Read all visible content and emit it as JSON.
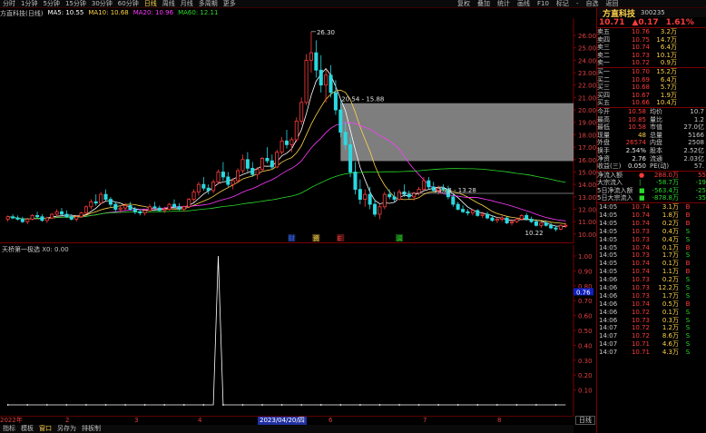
{
  "periods": [
    "分时",
    "1分钟",
    "5分钟",
    "15分钟",
    "30分钟",
    "60分钟",
    "日线",
    "周线",
    "月线",
    "多周期",
    "更多"
  ],
  "active_period": "日线",
  "right_tools": [
    "复权",
    "叠加",
    "统计",
    "画线",
    "F10",
    "标记",
    "-",
    "自选",
    "返回"
  ],
  "ma_legend": {
    "title": "方直科技(日线)",
    "ma5": "MA5: 10.55",
    "ma10": "MA10: 10.68",
    "ma20": "MA20: 10.96",
    "ma60": "MA60: 12.11",
    "colors": {
      "ma5": "#ffffff",
      "ma10": "#ffd24a",
      "ma20": "#ff3bff",
      "ma60": "#2bd92b"
    }
  },
  "price_axis": [
    "26.00",
    "25.00",
    "24.00",
    "23.00",
    "22.00",
    "21.00",
    "20.00",
    "19.00",
    "18.00",
    "17.00",
    "16.00",
    "15.00",
    "14.00",
    "13.00",
    "12.00",
    "11.00",
    "10.00"
  ],
  "annotations": {
    "high": "26.30",
    "range_box": "20.54 - 15.88",
    "line_label": "13.28 - 13.28",
    "low": "10.22"
  },
  "markers": [
    "财",
    "资",
    "E",
    "调"
  ],
  "sub_legend": "天桥第一极选 X0: 0.00",
  "sub_axis": [
    "1.00",
    "0.90",
    "0.80",
    "0.70",
    "0.60",
    "0.50",
    "0.40",
    "0.30",
    "0.20",
    "0.10"
  ],
  "sub_cursor": "0.76",
  "dates": [
    "2022年",
    "2",
    "3",
    "4",
    "2023/04/20/四",
    "6",
    "7",
    "8"
  ],
  "bottom_tabs": [
    "指标",
    "模板",
    "窗口",
    "另存为",
    "排板制"
  ],
  "active_bottom_tab": "窗口",
  "period_ctrl": "日线",
  "stock": {
    "name": "方直科技",
    "code": "300235",
    "price": "10.71",
    "change": "▲0.17",
    "pct": "1.61%"
  },
  "asks": [
    {
      "label": "卖五",
      "price": "10.76",
      "vol": "3.2万",
      "chg": ""
    },
    {
      "label": "卖四",
      "price": "10.75",
      "vol": "14.7万",
      "chg": ""
    },
    {
      "label": "卖三",
      "price": "10.74",
      "vol": "6.4万",
      "chg": ""
    },
    {
      "label": "卖二",
      "price": "10.73",
      "vol": "10.1万",
      "chg": ""
    },
    {
      "label": "卖一",
      "price": "10.72",
      "vol": "0.9万",
      "chg": ""
    }
  ],
  "bids": [
    {
      "label": "买一",
      "price": "10.70",
      "vol": "15.2万",
      "chg": ""
    },
    {
      "label": "买二",
      "price": "10.69",
      "vol": "6.4万",
      "chg": ""
    },
    {
      "label": "买三",
      "price": "10.68",
      "vol": "5.7万",
      "chg": ""
    },
    {
      "label": "买四",
      "price": "10.67",
      "vol": "1.9万",
      "chg": ""
    },
    {
      "label": "买五",
      "price": "10.66",
      "vol": "10.4万",
      "chg": ""
    }
  ],
  "stats": [
    {
      "l1": "今开",
      "v1": "10.58",
      "c1": "red",
      "l2": "均价",
      "v2": "10.7"
    },
    {
      "l1": "最高",
      "v1": "10.85",
      "c1": "red",
      "l2": "量比",
      "v2": "1.2"
    },
    {
      "l1": "最低",
      "v1": "10.58",
      "c1": "red",
      "l2": "市值",
      "v2": "27.0亿"
    },
    {
      "l1": "现量",
      "v1": "48",
      "c1": "yel",
      "l2": "总量",
      "v2": "5166"
    },
    {
      "l1": "外盘",
      "v1": "26574",
      "c1": "red",
      "l2": "内盘",
      "v2": "2508"
    },
    {
      "l1": "换手",
      "v1": "2.54%",
      "c1": "white",
      "l2": "股本",
      "v2": "2.52亿"
    },
    {
      "l1": "净资",
      "v1": "2.76",
      "c1": "white",
      "l2": "流通",
      "v2": "2.03亿"
    },
    {
      "l1": "收益(三)",
      "v1": "0.050",
      "c1": "white",
      "l2": "PE(动)",
      "v2": "57."
    }
  ],
  "flows": [
    {
      "label": "净流入额",
      "dot": "●",
      "v": "288.0万",
      "vc": "red",
      "v2": "55"
    },
    {
      "label": "大宗流入",
      "dot": "|",
      "v": "-58.7万",
      "vc": "green",
      "v2": "-19"
    },
    {
      "label": "5日净流入额",
      "dot": "■",
      "v": "-563.4万",
      "vc": "green",
      "v2": "-25"
    },
    {
      "label": "5日大宗流入",
      "dot": "■",
      "v": "-878.8万",
      "vc": "green",
      "v2": "-35"
    }
  ],
  "ticks": [
    {
      "t": "14:05",
      "p": "10.74",
      "v": "3.1万",
      "s": "B"
    },
    {
      "t": "14:05",
      "p": "10.74",
      "v": "1.8万",
      "s": "B"
    },
    {
      "t": "14:05",
      "p": "10.74",
      "v": "0.2万",
      "s": "B"
    },
    {
      "t": "14:05",
      "p": "10.73",
      "v": "0.4万",
      "s": "S"
    },
    {
      "t": "14:05",
      "p": "10.73",
      "v": "0.4万",
      "s": "S"
    },
    {
      "t": "14:05",
      "p": "10.74",
      "v": "0.1万",
      "s": "B"
    },
    {
      "t": "14:05",
      "p": "10.73",
      "v": "1.7万",
      "s": "S"
    },
    {
      "t": "14:05",
      "p": "10.74",
      "v": "0.1万",
      "s": "B"
    },
    {
      "t": "14:05",
      "p": "10.74",
      "v": "1.1万",
      "s": "B"
    },
    {
      "t": "14:06",
      "p": "10.73",
      "v": "0.2万",
      "s": "S"
    },
    {
      "t": "14:06",
      "p": "10.73",
      "v": "12.2万",
      "s": "S"
    },
    {
      "t": "14:06",
      "p": "10.73",
      "v": "1.7万",
      "s": "S"
    },
    {
      "t": "14:06",
      "p": "10.74",
      "v": "0.5万",
      "s": "B"
    },
    {
      "t": "14:06",
      "p": "10.72",
      "v": "0.1万",
      "s": "S"
    },
    {
      "t": "14:06",
      "p": "10.73",
      "v": "0.3万",
      "s": "S"
    },
    {
      "t": "14:07",
      "p": "10.72",
      "v": "1.2万",
      "s": "S"
    },
    {
      "t": "14:07",
      "p": "10.72",
      "v": "8.6万",
      "s": "S"
    },
    {
      "t": "14:07",
      "p": "10.71",
      "v": "4.6万",
      "s": "S"
    },
    {
      "t": "14:07",
      "p": "10.71",
      "v": "4.3万",
      "s": "S"
    }
  ],
  "colors": {
    "up": "#ff3b3b",
    "down": "#2bd9e0",
    "accent": "#ffd24a",
    "grid": "#7a0000"
  },
  "candles": [
    [
      11.2,
      11.5,
      11.0,
      11.4
    ],
    [
      11.4,
      11.6,
      11.2,
      11.3
    ],
    [
      11.3,
      11.5,
      11.1,
      11.2
    ],
    [
      11.2,
      11.4,
      10.9,
      11.0
    ],
    [
      11.0,
      11.3,
      10.8,
      11.2
    ],
    [
      11.2,
      11.6,
      11.1,
      11.5
    ],
    [
      11.5,
      11.8,
      11.3,
      11.4
    ],
    [
      11.4,
      11.6,
      11.0,
      11.1
    ],
    [
      11.1,
      11.4,
      10.9,
      11.3
    ],
    [
      11.3,
      11.7,
      11.2,
      11.6
    ],
    [
      11.6,
      12.0,
      11.4,
      11.8
    ],
    [
      11.8,
      12.1,
      11.5,
      11.6
    ],
    [
      11.6,
      11.9,
      11.3,
      11.4
    ],
    [
      11.4,
      11.6,
      11.1,
      11.2
    ],
    [
      11.2,
      11.5,
      11.0,
      11.4
    ],
    [
      11.4,
      11.8,
      11.3,
      11.7
    ],
    [
      11.7,
      12.3,
      11.6,
      12.2
    ],
    [
      12.2,
      12.8,
      12.0,
      12.6
    ],
    [
      12.6,
      13.2,
      12.3,
      12.5
    ],
    [
      12.5,
      13.4,
      12.4,
      13.2
    ],
    [
      13.2,
      13.6,
      12.7,
      12.8
    ],
    [
      12.8,
      13.0,
      12.2,
      12.4
    ],
    [
      12.4,
      12.6,
      11.8,
      12.0
    ],
    [
      12.0,
      12.3,
      11.7,
      12.1
    ],
    [
      12.1,
      12.5,
      11.9,
      12.3
    ],
    [
      12.3,
      12.6,
      11.9,
      12.0
    ],
    [
      12.0,
      12.2,
      11.6,
      11.8
    ],
    [
      11.8,
      12.0,
      11.5,
      11.7
    ],
    [
      11.7,
      12.0,
      11.5,
      11.9
    ],
    [
      11.9,
      12.4,
      11.8,
      12.2
    ],
    [
      12.2,
      12.6,
      12.0,
      12.1
    ],
    [
      12.1,
      12.3,
      11.8,
      11.9
    ],
    [
      11.9,
      12.2,
      11.7,
      12.0
    ],
    [
      12.0,
      12.5,
      11.9,
      12.4
    ],
    [
      12.4,
      12.8,
      12.1,
      12.2
    ],
    [
      12.2,
      12.5,
      11.9,
      12.0
    ],
    [
      12.0,
      12.3,
      11.8,
      12.2
    ],
    [
      12.2,
      12.9,
      12.1,
      12.8
    ],
    [
      12.8,
      13.6,
      12.6,
      13.4
    ],
    [
      13.4,
      14.2,
      13.1,
      14.0
    ],
    [
      14.0,
      14.6,
      13.5,
      13.7
    ],
    [
      13.7,
      14.0,
      13.2,
      13.5
    ],
    [
      13.5,
      14.4,
      13.3,
      14.2
    ],
    [
      14.2,
      15.2,
      14.0,
      15.0
    ],
    [
      15.0,
      15.8,
      14.3,
      14.6
    ],
    [
      14.6,
      15.0,
      13.8,
      14.0
    ],
    [
      14.0,
      14.5,
      13.6,
      14.3
    ],
    [
      14.3,
      15.3,
      14.1,
      15.1
    ],
    [
      15.1,
      16.4,
      14.9,
      16.0
    ],
    [
      16.0,
      16.6,
      15.0,
      15.3
    ],
    [
      15.3,
      15.8,
      14.6,
      14.8
    ],
    [
      14.8,
      15.4,
      14.4,
      15.2
    ],
    [
      15.2,
      16.2,
      15.0,
      16.1
    ],
    [
      16.1,
      17.0,
      15.7,
      15.9
    ],
    [
      15.9,
      16.4,
      15.2,
      15.4
    ],
    [
      15.4,
      16.8,
      15.3,
      16.6
    ],
    [
      16.6,
      17.8,
      16.4,
      17.5
    ],
    [
      17.5,
      18.4,
      16.9,
      17.2
    ],
    [
      17.2,
      17.8,
      16.6,
      17.6
    ],
    [
      17.6,
      19.4,
      17.4,
      19.1
    ],
    [
      19.1,
      21.0,
      18.8,
      20.6
    ],
    [
      20.6,
      24.5,
      20.4,
      24.0
    ],
    [
      24.0,
      26.3,
      23.0,
      24.6
    ],
    [
      24.6,
      25.6,
      22.6,
      23.2
    ],
    [
      23.2,
      24.4,
      21.4,
      22.0
    ],
    [
      22.0,
      23.2,
      20.6,
      22.8
    ],
    [
      22.8,
      23.6,
      21.0,
      21.4
    ],
    [
      21.4,
      22.4,
      19.6,
      20.0
    ],
    [
      20.0,
      20.8,
      17.8,
      18.2
    ],
    [
      18.2,
      19.0,
      16.8,
      17.2
    ],
    [
      17.2,
      17.8,
      14.6,
      15.0
    ],
    [
      15.0,
      15.8,
      13.2,
      13.6
    ],
    [
      13.6,
      14.4,
      12.4,
      12.8
    ],
    [
      12.8,
      13.6,
      12.2,
      13.2
    ],
    [
      13.2,
      13.8,
      12.0,
      12.4
    ],
    [
      12.4,
      12.8,
      11.4,
      11.6
    ],
    [
      11.6,
      12.4,
      11.2,
      12.2
    ],
    [
      12.2,
      13.4,
      12.0,
      13.2
    ],
    [
      13.2,
      13.6,
      12.8,
      13.0
    ],
    [
      13.0,
      13.4,
      12.6,
      12.8
    ],
    [
      12.8,
      13.6,
      12.7,
      13.4
    ],
    [
      13.4,
      14.0,
      13.0,
      13.2
    ],
    [
      13.2,
      13.5,
      12.8,
      13.0
    ],
    [
      13.0,
      13.4,
      12.7,
      13.3
    ],
    [
      13.3,
      13.8,
      13.1,
      13.6
    ],
    [
      13.6,
      14.6,
      13.5,
      14.3
    ],
    [
      14.3,
      14.6,
      13.6,
      13.8
    ],
    [
      13.8,
      14.2,
      13.4,
      13.5
    ],
    [
      13.5,
      13.9,
      13.2,
      13.7
    ],
    [
      13.7,
      14.0,
      13.4,
      13.6
    ],
    [
      13.6,
      13.9,
      12.8,
      13.0
    ],
    [
      13.0,
      13.2,
      12.2,
      12.4
    ],
    [
      12.4,
      12.6,
      11.9,
      12.0
    ],
    [
      12.0,
      12.3,
      11.7,
      11.8
    ],
    [
      11.8,
      12.0,
      11.5,
      11.7
    ],
    [
      11.7,
      12.0,
      11.5,
      11.9
    ],
    [
      11.9,
      12.0,
      11.4,
      11.5
    ],
    [
      11.5,
      11.8,
      11.3,
      11.6
    ],
    [
      11.6,
      11.8,
      11.2,
      11.3
    ],
    [
      11.3,
      11.5,
      11.0,
      11.1
    ],
    [
      11.1,
      11.4,
      10.9,
      11.2
    ],
    [
      11.2,
      11.5,
      11.0,
      11.3
    ],
    [
      11.3,
      11.4,
      10.8,
      10.9
    ],
    [
      10.9,
      11.2,
      10.7,
      11.0
    ],
    [
      11.0,
      11.3,
      10.9,
      11.2
    ],
    [
      11.2,
      11.6,
      11.1,
      11.5
    ],
    [
      11.5,
      11.7,
      11.1,
      11.2
    ],
    [
      11.2,
      11.4,
      10.9,
      11.0
    ],
    [
      11.0,
      11.2,
      10.6,
      10.7
    ],
    [
      10.7,
      11.0,
      10.5,
      10.9
    ],
    [
      10.9,
      11.1,
      10.6,
      10.7
    ],
    [
      10.7,
      10.9,
      10.4,
      10.5
    ],
    [
      10.5,
      10.7,
      10.22,
      10.4
    ],
    [
      10.4,
      10.8,
      10.3,
      10.7
    ],
    [
      10.7,
      10.9,
      10.5,
      10.71
    ]
  ]
}
